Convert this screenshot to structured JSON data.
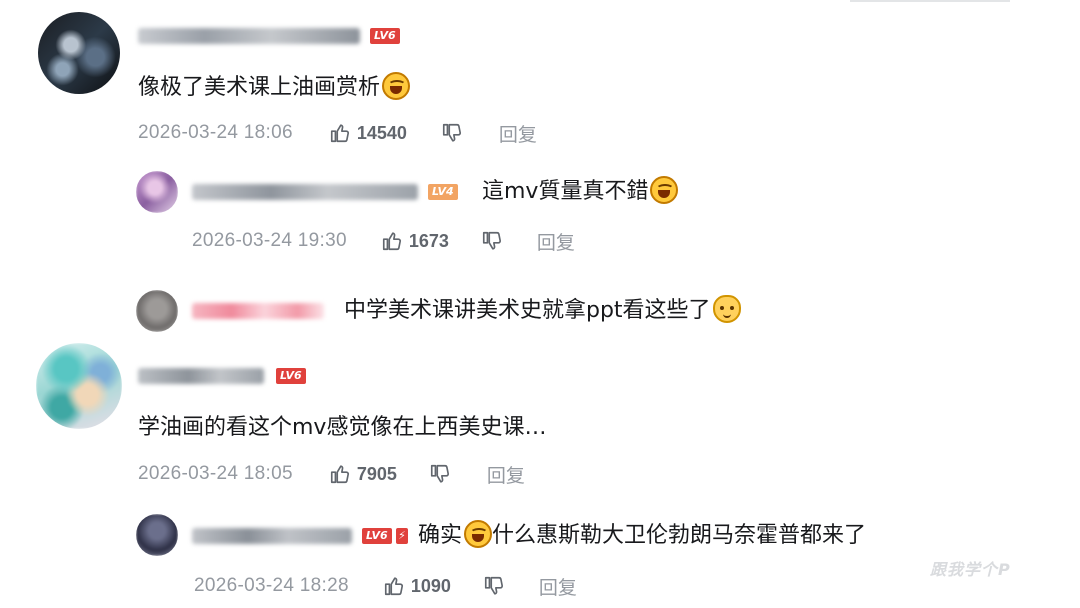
{
  "comments": [
    {
      "level": "LV6",
      "text": "像极了美术课上油画赏析",
      "emoji": "laughing-crying-emoji",
      "date": "2026-03-24 18:06",
      "likes": "14540",
      "reply_label": "回复"
    },
    {
      "level": "LV4",
      "text": "這mv質量真不錯",
      "emoji": "laughing-crying-emoji",
      "date": "2026-03-24 19:30",
      "likes": "1673",
      "reply_label": "回复"
    },
    {
      "text": "中学美术课讲美术史就拿ppt看这些了",
      "emoji": "cat-emoji"
    },
    {
      "level": "LV6",
      "text": "学油画的看这个mv感觉像在上西美史课…",
      "date": "2026-03-24 18:05",
      "likes": "7905",
      "reply_label": "回复"
    },
    {
      "level": "LV6",
      "text_before": "确实",
      "emoji": "laughing-crying-emoji",
      "text_after": "什么惠斯勒大卫伦勃朗马奈霍普都来了",
      "date": "2026-03-24 18:28",
      "likes": "1090",
      "reply_label": "回复"
    }
  ],
  "watermark": "跟我学个P",
  "colors": {
    "level_red": "#e0413c",
    "level_orange": "#f2a463",
    "meta_gray": "#9499a0",
    "text": "#18191c"
  }
}
